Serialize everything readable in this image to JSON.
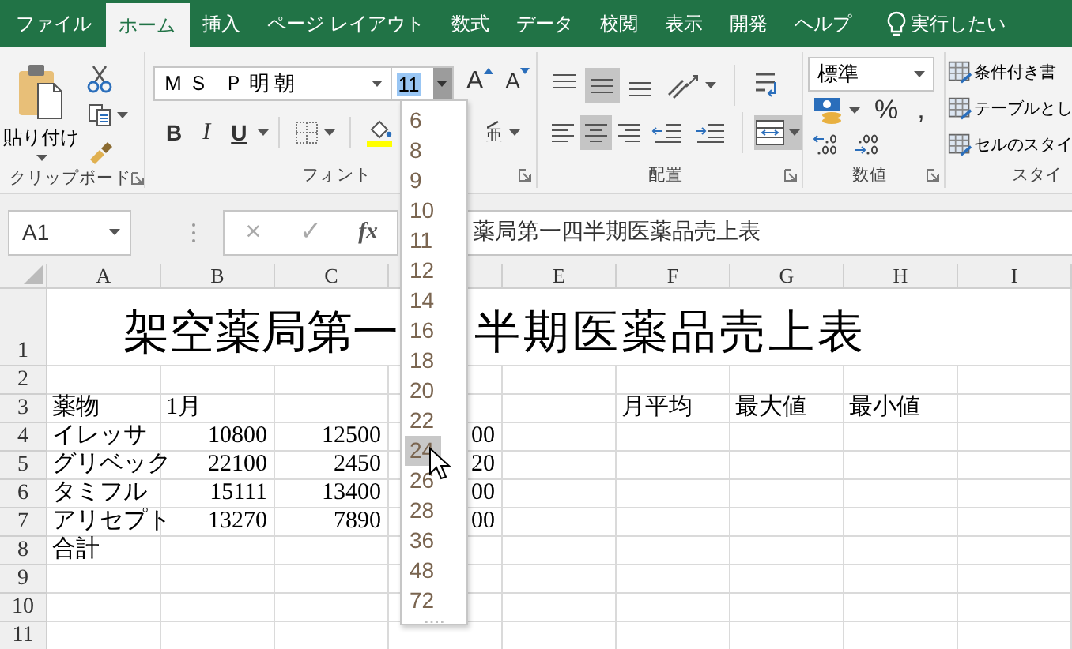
{
  "tabs": [
    {
      "label": "ファイル",
      "selected": false
    },
    {
      "label": "ホーム",
      "selected": true
    },
    {
      "label": "挿入",
      "selected": false
    },
    {
      "label": "ページ レイアウト",
      "selected": false
    },
    {
      "label": "数式",
      "selected": false
    },
    {
      "label": "データ",
      "selected": false
    },
    {
      "label": "校閲",
      "selected": false
    },
    {
      "label": "表示",
      "selected": false
    },
    {
      "label": "開発",
      "selected": false
    },
    {
      "label": "ヘルプ",
      "selected": false
    }
  ],
  "tell_me": {
    "text": "実行したい"
  },
  "ribbon": {
    "clipboard": {
      "paste_label": "貼り付け",
      "group_label": "クリップボード"
    },
    "font": {
      "font_name": "ＭＳ Ｐ明朝",
      "font_size": "11",
      "size_text_selected": true,
      "grow": "A",
      "shrink": "A",
      "bold": "B",
      "italic": "I",
      "underline": "U",
      "phonetic": "亜",
      "group_label": "フォント"
    },
    "alignment": {
      "vertical": [
        {
          "kind": "top",
          "selected": false
        },
        {
          "kind": "middle",
          "selected": true
        },
        {
          "kind": "bottom",
          "selected": false
        }
      ],
      "horizontal": [
        {
          "kind": "left",
          "selected": false
        },
        {
          "kind": "center",
          "selected": true
        },
        {
          "kind": "right",
          "selected": false
        }
      ],
      "merge_selected": true,
      "group_label": "配置"
    },
    "number": {
      "format": "標準",
      "percent": "%",
      "comma": ",",
      "group_label": "数値"
    },
    "styles": {
      "items": [
        "条件付き書",
        "テーブルとし",
        "セルのスタイ"
      ],
      "group_label": "スタイ"
    }
  },
  "formula_bar": {
    "name_box": "A1",
    "cancel": "×",
    "enter": "✓",
    "function": "fx",
    "content": "薬局第一四半期医薬品売上表"
  },
  "sheet": {
    "columns": [
      {
        "label": "A"
      },
      {
        "label": "B"
      },
      {
        "label": "C"
      },
      {},
      {
        "label": "E"
      },
      {
        "label": "F"
      },
      {
        "label": "G"
      },
      {
        "label": "H"
      },
      {
        "label": "I"
      }
    ],
    "rows": [
      {
        "number": "1",
        "title_parts": [
          "架空薬局第一",
          "半期医薬品売上表"
        ]
      },
      {
        "number": "2"
      },
      {
        "number": "3",
        "cells": [
          {
            "text": "薬物"
          },
          {
            "text": "1月"
          },
          {},
          {},
          {},
          {
            "text": "月平均"
          },
          {
            "text": "最大値"
          },
          {
            "text": "最小値"
          }
        ]
      },
      {
        "number": "4",
        "cells": [
          {
            "text": "イレッサ"
          },
          {
            "text": "10800",
            "kind": "number"
          },
          {
            "text": "12500",
            "kind": "number"
          },
          {
            "text": "00",
            "kind": "number"
          }
        ]
      },
      {
        "number": "5",
        "cells": [
          {
            "text": "グリベック"
          },
          {
            "text": "22100",
            "kind": "number"
          },
          {
            "text": "2450",
            "kind": "number"
          },
          {
            "text": "20",
            "kind": "number"
          }
        ]
      },
      {
        "number": "6",
        "cells": [
          {
            "text": "タミフル"
          },
          {
            "text": "15111",
            "kind": "number"
          },
          {
            "text": "13400",
            "kind": "number"
          },
          {
            "text": "00",
            "kind": "number"
          }
        ]
      },
      {
        "number": "7",
        "cells": [
          {
            "text": "アリセプト"
          },
          {
            "text": "13270",
            "kind": "number"
          },
          {
            "text": "7890",
            "kind": "number"
          },
          {
            "text": "00",
            "kind": "number"
          }
        ]
      },
      {
        "number": "8",
        "cells": [
          {
            "text": "合計"
          }
        ]
      },
      {
        "number": "9"
      },
      {
        "number": "10"
      },
      {
        "number": "11"
      }
    ]
  },
  "size_dropdown": {
    "items": [
      {
        "label": "6",
        "hovered": false
      },
      {
        "label": "8",
        "hovered": false
      },
      {
        "label": "9",
        "hovered": false
      },
      {
        "label": "10",
        "hovered": false
      },
      {
        "label": "11",
        "hovered": false
      },
      {
        "label": "12",
        "hovered": false
      },
      {
        "label": "14",
        "hovered": false
      },
      {
        "label": "16",
        "hovered": false
      },
      {
        "label": "18",
        "hovered": false
      },
      {
        "label": "20",
        "hovered": false
      },
      {
        "label": "22",
        "hovered": false
      },
      {
        "label": "24",
        "hovered": true
      },
      {
        "label": "26",
        "hovered": false
      },
      {
        "label": "28",
        "hovered": false
      },
      {
        "label": "36",
        "hovered": false
      },
      {
        "label": "48",
        "hovered": false
      },
      {
        "label": "72",
        "hovered": false
      }
    ]
  }
}
